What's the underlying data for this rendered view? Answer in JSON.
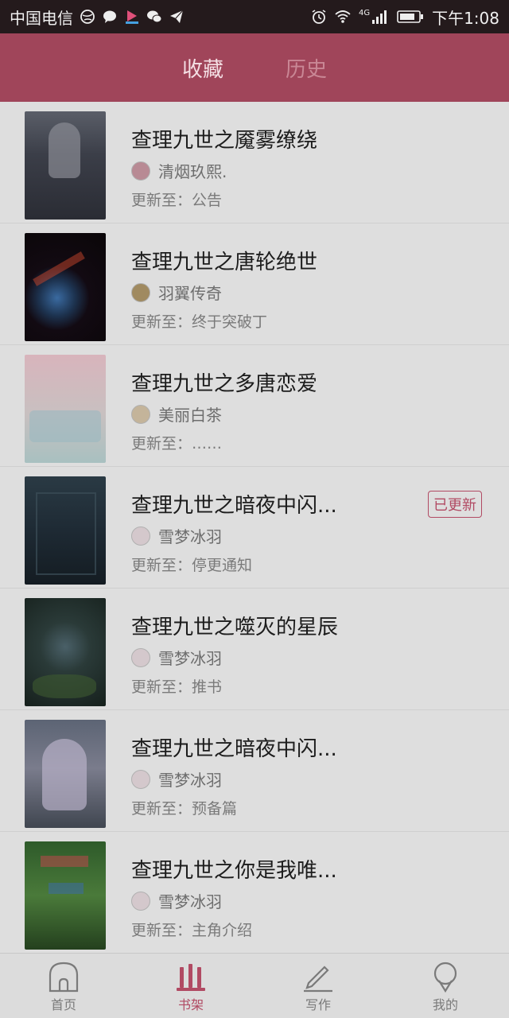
{
  "status_bar": {
    "carrier": "中国电信",
    "network": "4G",
    "time": "下午1:08"
  },
  "header": {
    "tabs": [
      {
        "label": "收藏",
        "active": true
      },
      {
        "label": "历史",
        "active": false
      }
    ]
  },
  "books": [
    {
      "title": "查理九世之魇雾缭绕",
      "author": "清烟玖熙.",
      "update": "更新至：公告",
      "badge": ""
    },
    {
      "title": "查理九世之唐轮绝世",
      "author": "羽翼传奇",
      "update": "更新至：终于突破丁",
      "badge": ""
    },
    {
      "title": "查理九世之多唐恋爱",
      "author": "美丽白茶",
      "update": "更新至：……",
      "badge": ""
    },
    {
      "title": "查理九世之暗夜中闪...",
      "author": "雪梦冰羽",
      "update": "更新至：停更通知",
      "badge": "已更新"
    },
    {
      "title": "查理九世之噬灭的星辰",
      "author": "雪梦冰羽",
      "update": "更新至：推书",
      "badge": ""
    },
    {
      "title": "查理九世之暗夜中闪...",
      "author": "雪梦冰羽",
      "update": "更新至：预备篇",
      "badge": ""
    },
    {
      "title": "查理九世之你是我唯...",
      "author": "雪梦冰羽",
      "update": "更新至：主角介绍",
      "badge": ""
    }
  ],
  "bottom_nav": [
    {
      "label": "首页",
      "icon": "home-icon",
      "active": false
    },
    {
      "label": "书架",
      "icon": "bookshelf-icon",
      "active": true
    },
    {
      "label": "写作",
      "icon": "pen-icon",
      "active": false
    },
    {
      "label": "我的",
      "icon": "profile-icon",
      "active": false
    }
  ],
  "colors": {
    "header_bg": "#a0455a",
    "accent": "#b14a63",
    "status_bar_bg": "#241a1c"
  }
}
